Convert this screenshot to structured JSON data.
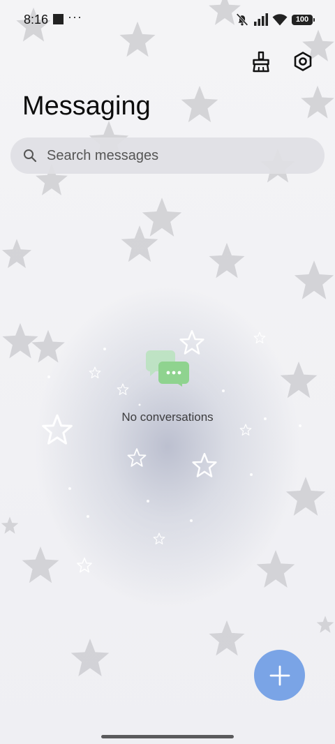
{
  "status_bar": {
    "time": "8:16",
    "overflow": "···",
    "battery": "100",
    "icons": [
      "square-notification-icon",
      "mute-vibrate-icon",
      "signal-icon",
      "wifi-icon",
      "battery-icon"
    ]
  },
  "header": {
    "title": "Messaging",
    "actions": [
      {
        "name": "clean-brush-icon",
        "label": "Clean up"
      },
      {
        "name": "settings-gear-icon",
        "label": "Settings"
      }
    ]
  },
  "search": {
    "placeholder": "Search messages",
    "value": ""
  },
  "empty_state": {
    "icon": "chat-bubbles-icon",
    "text": "No conversations",
    "icon_color": "#8fd38f"
  },
  "fab": {
    "icon": "plus-icon",
    "color": "#7aa4e6"
  }
}
